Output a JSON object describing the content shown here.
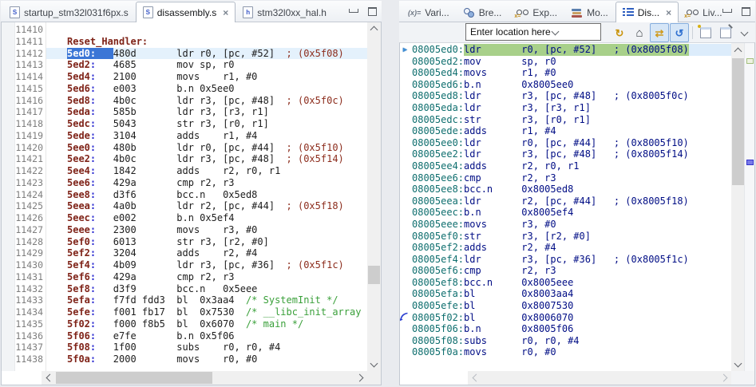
{
  "icons": {
    "close_glyph": "×",
    "variables_glyph": "(x)=",
    "xeq_glyph": "x=",
    "refresh_glyph": "↻",
    "home_glyph": "⌂",
    "follow_glyph": "⇄",
    "sync_glyph": "↺",
    "file_letter_s": "S",
    "file_letter_h": "h",
    "pointer_glyph": "►"
  },
  "colors": {
    "selection_blue": "#3b76d6",
    "current_line_blue": "#e4f1fc",
    "ip_highlight_green": "#a8d08a",
    "address_maroon": "#7f2318",
    "right_address_teal": "#0e6e6e",
    "right_instruction_navy": "#000d85",
    "block_comment_green": "#3aa03a"
  },
  "left_editor": {
    "tabs": [
      {
        "label": "startup_stm32l031f6px.s",
        "active": false
      },
      {
        "label": "disassembly.s",
        "active": true,
        "closable": true
      },
      {
        "label": "stm32l0xx_hal.h",
        "active": false
      }
    ],
    "lines": [
      {
        "n": "11410",
        "t": "empty"
      },
      {
        "n": "11411",
        "t": "label",
        "label": "Reset_Handler:"
      },
      {
        "n": "11412",
        "t": "code",
        "addr": "5ed0",
        "op": "480d",
        "ins": "ldr r0, [pc, #52]",
        "cmt": "; (0x5f08)",
        "cur": true,
        "sel": true
      },
      {
        "n": "11413",
        "t": "code",
        "addr": "5ed2",
        "op": "4685",
        "ins": "mov sp, r0"
      },
      {
        "n": "11414",
        "t": "code",
        "addr": "5ed4",
        "op": "2100",
        "ins": "movs    r1, #0"
      },
      {
        "n": "11415",
        "t": "code",
        "addr": "5ed6",
        "op": "e003",
        "ins": "b.n 0x5ee0"
      },
      {
        "n": "11416",
        "t": "code",
        "addr": "5ed8",
        "op": "4b0c",
        "ins": "ldr r3, [pc, #48]",
        "cmt": "; (0x5f0c)"
      },
      {
        "n": "11417",
        "t": "code",
        "addr": "5eda",
        "op": "585b",
        "ins": "ldr r3, [r3, r1]"
      },
      {
        "n": "11418",
        "t": "code",
        "addr": "5edc",
        "op": "5043",
        "ins": "str r3, [r0, r1]"
      },
      {
        "n": "11419",
        "t": "code",
        "addr": "5ede",
        "op": "3104",
        "ins": "adds    r1, #4"
      },
      {
        "n": "11420",
        "t": "code",
        "addr": "5ee0",
        "op": "480b",
        "ins": "ldr r0, [pc, #44]",
        "cmt": "; (0x5f10)"
      },
      {
        "n": "11421",
        "t": "code",
        "addr": "5ee2",
        "op": "4b0c",
        "ins": "ldr r3, [pc, #48]",
        "cmt": "; (0x5f14)"
      },
      {
        "n": "11422",
        "t": "code",
        "addr": "5ee4",
        "op": "1842",
        "ins": "adds    r2, r0, r1"
      },
      {
        "n": "11423",
        "t": "code",
        "addr": "5ee6",
        "op": "429a",
        "ins": "cmp r2, r3"
      },
      {
        "n": "11424",
        "t": "code",
        "addr": "5ee8",
        "op": "d3f6",
        "ins": "bcc.n   0x5ed8"
      },
      {
        "n": "11425",
        "t": "code",
        "addr": "5eea",
        "op": "4a0b",
        "ins": "ldr r2, [pc, #44]",
        "cmt": "; (0x5f18)"
      },
      {
        "n": "11426",
        "t": "code",
        "addr": "5eec",
        "op": "e002",
        "ins": "b.n 0x5ef4"
      },
      {
        "n": "11427",
        "t": "code",
        "addr": "5eee",
        "op": "2300",
        "ins": "movs    r3, #0"
      },
      {
        "n": "11428",
        "t": "code",
        "addr": "5ef0",
        "op": "6013",
        "ins": "str r3, [r2, #0]"
      },
      {
        "n": "11429",
        "t": "code",
        "addr": "5ef2",
        "op": "3204",
        "ins": "adds    r2, #4"
      },
      {
        "n": "11430",
        "t": "code",
        "addr": "5ef4",
        "op": "4b09",
        "ins": "ldr r3, [pc, #36]",
        "cmt": "; (0x5f1c)"
      },
      {
        "n": "11431",
        "t": "code",
        "addr": "5ef6",
        "op": "429a",
        "ins": "cmp r2, r3"
      },
      {
        "n": "11432",
        "t": "code",
        "addr": "5ef8",
        "op": "d3f9",
        "ins": "bcc.n   0x5eee"
      },
      {
        "n": "11433",
        "t": "code",
        "addr": "5efa",
        "op": "f7fd fdd3",
        "ins": "bl  0x3aa4",
        "gcmt": "/* SystemInit */"
      },
      {
        "n": "11434",
        "t": "code",
        "addr": "5efe",
        "op": "f001 fb17",
        "ins": "bl  0x7530",
        "gcmt": "/* __libc_init_array */"
      },
      {
        "n": "11435",
        "t": "code",
        "addr": "5f02",
        "op": "f000 f8b5",
        "ins": "bl  0x6070",
        "gcmt": "/* main */"
      },
      {
        "n": "11436",
        "t": "code",
        "addr": "5f06",
        "op": "e7fe",
        "ins": "b.n 0x5f06"
      },
      {
        "n": "11437",
        "t": "code",
        "addr": "5f08",
        "op": "1f00",
        "ins": "subs    r0, r0, #4"
      },
      {
        "n": "11438",
        "t": "code",
        "addr": "5f0a",
        "op": "2000",
        "ins": "movs    r0, #0"
      }
    ]
  },
  "right_view": {
    "tabs": [
      {
        "label": "Vari...",
        "active": false
      },
      {
        "label": "Bre...",
        "active": false
      },
      {
        "label": "Exp...",
        "active": false
      },
      {
        "label": "Mo...",
        "active": false
      },
      {
        "label": "Dis...",
        "active": true,
        "closable": true
      },
      {
        "label": "Liv...",
        "active": false
      }
    ],
    "toolbar": {
      "location_value": "Enter location here",
      "buttons": [
        {
          "icon": "refresh-view-icon",
          "pressed": false
        },
        {
          "icon": "home-icon",
          "pressed": false
        },
        {
          "icon": "follow-execution-icon",
          "pressed": true
        },
        {
          "icon": "sync-context-icon",
          "pressed": true
        },
        {
          "icon": "open-new-view-icon",
          "pressed": false
        },
        {
          "icon": "pin-view-icon",
          "pressed": false
        },
        {
          "icon": "view-menu-icon",
          "pressed": false
        }
      ]
    },
    "rows": [
      {
        "addr": "08005ed0:",
        "mn": "ldr",
        "ops": "r0, [pc, #52]",
        "cmt": "; (0x8005f08)",
        "cur": true
      },
      {
        "addr": "08005ed2:",
        "mn": "mov",
        "ops": "sp, r0"
      },
      {
        "addr": "08005ed4:",
        "mn": "movs",
        "ops": "r1, #0"
      },
      {
        "addr": "08005ed6:",
        "mn": "b.n",
        "ops": "0x8005ee0"
      },
      {
        "addr": "08005ed8:",
        "mn": "ldr",
        "ops": "r3, [pc, #48]",
        "cmt": "; (0x8005f0c)"
      },
      {
        "addr": "08005eda:",
        "mn": "ldr",
        "ops": "r3, [r3, r1]"
      },
      {
        "addr": "08005edc:",
        "mn": "str",
        "ops": "r3, [r0, r1]"
      },
      {
        "addr": "08005ede:",
        "mn": "adds",
        "ops": "r1, #4"
      },
      {
        "addr": "08005ee0:",
        "mn": "ldr",
        "ops": "r0, [pc, #44]",
        "cmt": "; (0x8005f10)"
      },
      {
        "addr": "08005ee2:",
        "mn": "ldr",
        "ops": "r3, [pc, #48]",
        "cmt": "; (0x8005f14)"
      },
      {
        "addr": "08005ee4:",
        "mn": "adds",
        "ops": "r2, r0, r1"
      },
      {
        "addr": "08005ee6:",
        "mn": "cmp",
        "ops": "r2, r3"
      },
      {
        "addr": "08005ee8:",
        "mn": "bcc.n",
        "ops": "0x8005ed8"
      },
      {
        "addr": "08005eea:",
        "mn": "ldr",
        "ops": "r2, [pc, #44]",
        "cmt": "; (0x8005f18)"
      },
      {
        "addr": "08005eec:",
        "mn": "b.n",
        "ops": "0x8005ef4"
      },
      {
        "addr": "08005eee:",
        "mn": "movs",
        "ops": "r3, #0"
      },
      {
        "addr": "08005ef0:",
        "mn": "str",
        "ops": "r3, [r2, #0]"
      },
      {
        "addr": "08005ef2:",
        "mn": "adds",
        "ops": "r2, #4"
      },
      {
        "addr": "08005ef4:",
        "mn": "ldr",
        "ops": "r3, [pc, #36]",
        "cmt": "; (0x8005f1c)"
      },
      {
        "addr": "08005ef6:",
        "mn": "cmp",
        "ops": "r2, r3"
      },
      {
        "addr": "08005ef8:",
        "mn": "bcc.n",
        "ops": "0x8005eee"
      },
      {
        "addr": "08005efa:",
        "mn": "bl",
        "ops": "0x8003aa4"
      },
      {
        "addr": "08005efe:",
        "mn": "bl",
        "ops": "0x8007530"
      },
      {
        "addr": "08005f02:",
        "mn": "bl",
        "ops": "0x8006070",
        "marker": true
      },
      {
        "addr": "08005f06:",
        "mn": "b.n",
        "ops": "0x8005f06"
      },
      {
        "addr": "08005f08:",
        "mn": "subs",
        "ops": "r0, r0, #4"
      },
      {
        "addr": "08005f0a:",
        "mn": "movs",
        "ops": "r0, #0"
      }
    ]
  }
}
